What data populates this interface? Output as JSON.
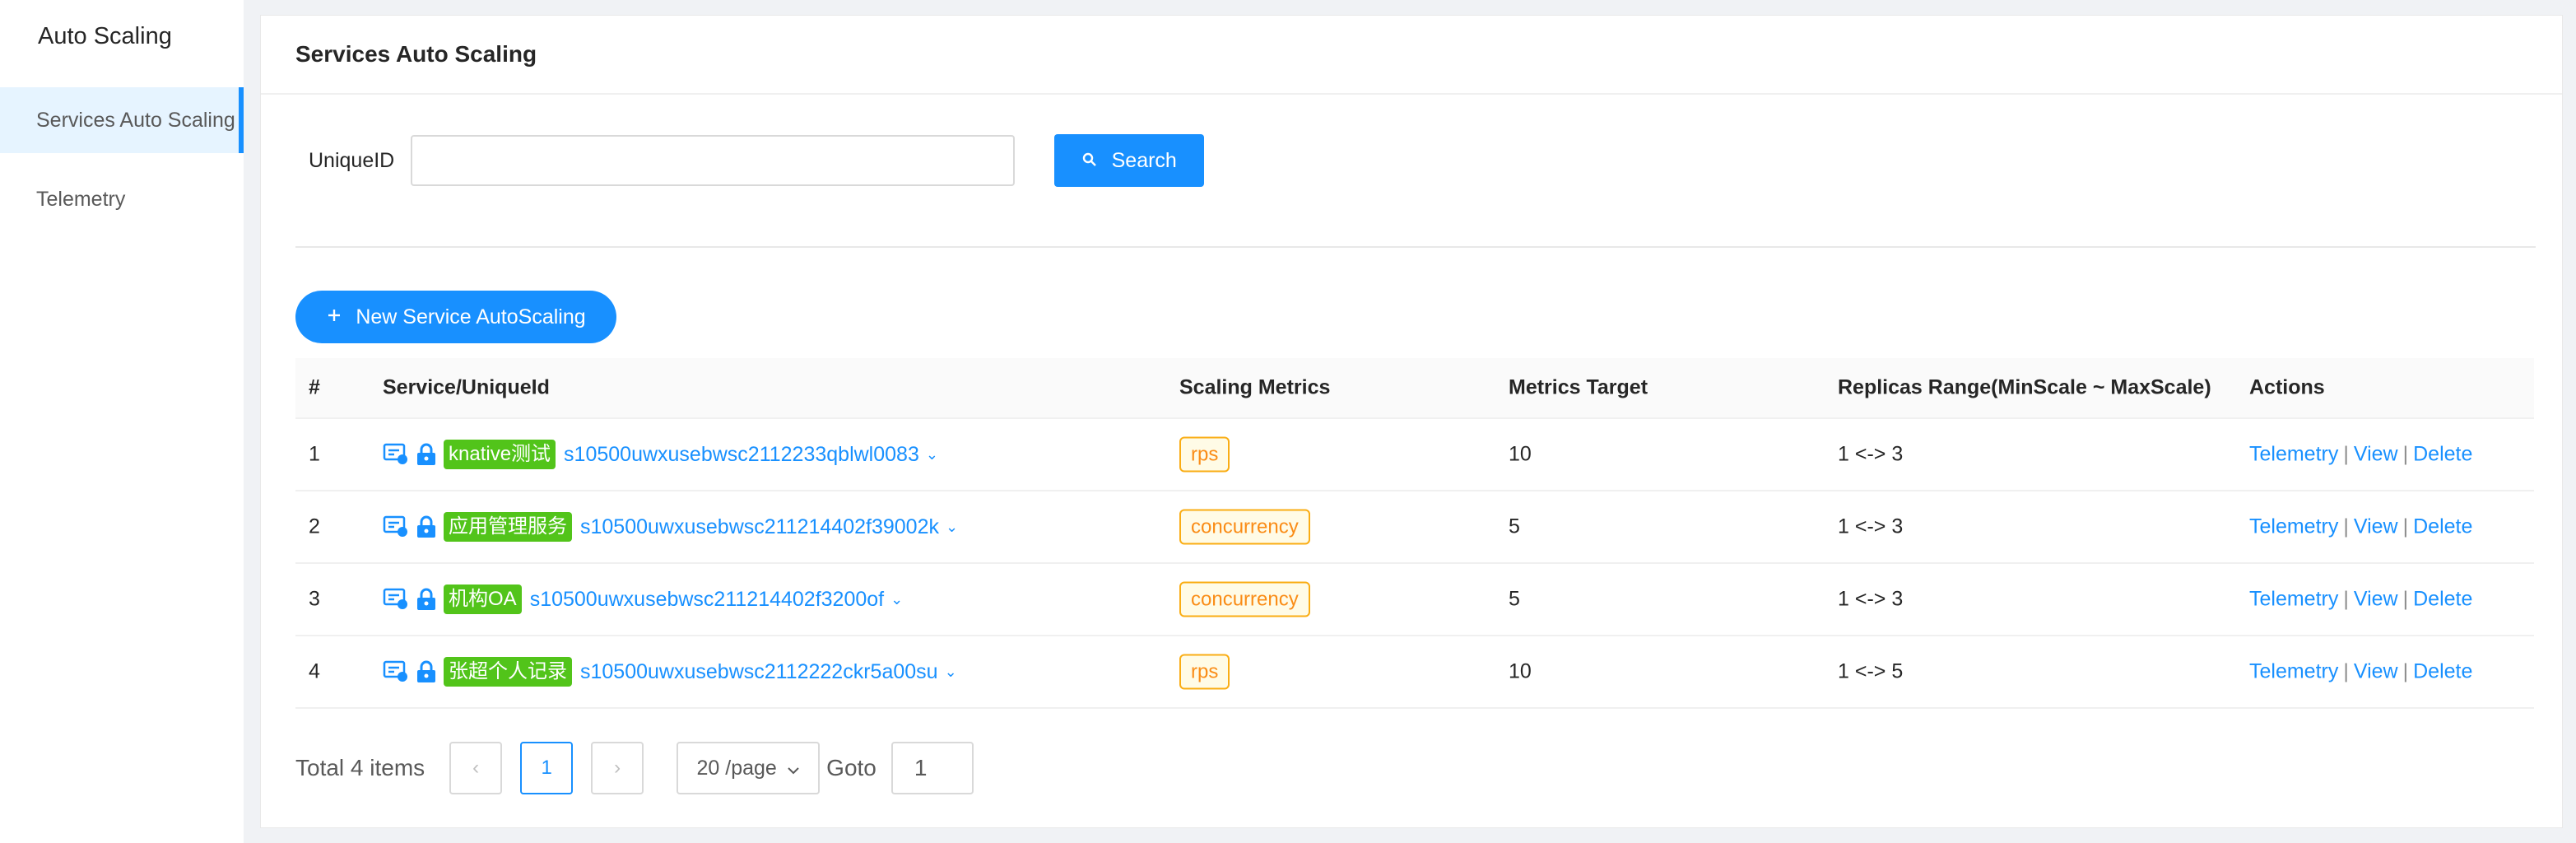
{
  "sidebar": {
    "title": "Auto Scaling",
    "items": [
      {
        "label": "Services Auto Scaling"
      },
      {
        "label": "Telemetry"
      }
    ]
  },
  "header": {
    "title": "Services Auto Scaling"
  },
  "search": {
    "label": "UniqueID",
    "value": "",
    "placeholder": "",
    "button_label": "Search"
  },
  "toolbar": {
    "new_label": "New Service AutoScaling"
  },
  "table": {
    "columns": [
      "#",
      "Service/UniqueId",
      "Scaling Metrics",
      "Metrics Target",
      "Replicas Range(MinScale ~ MaxScale)",
      "Actions"
    ],
    "rows": [
      {
        "index": "1",
        "name": "knative测试",
        "uid": "s10500uwxusebwsc2112233qblwl0083",
        "metric": "rps",
        "target": "10",
        "range": "1 <-> 3"
      },
      {
        "index": "2",
        "name": "应用管理服务",
        "uid": "s10500uwxusebwsc211214402f39002k",
        "metric": "concurrency",
        "target": "5",
        "range": "1 <-> 3"
      },
      {
        "index": "3",
        "name": "机构OA",
        "uid": "s10500uwxusebwsc211214402f3200of",
        "metric": "concurrency",
        "target": "5",
        "range": "1 <-> 3"
      },
      {
        "index": "4",
        "name": "张超个人记录",
        "uid": "s10500uwxusebwsc2112222ckr5a00su",
        "metric": "rps",
        "target": "10",
        "range": "1 <-> 5"
      }
    ],
    "actions": {
      "telemetry": "Telemetry",
      "view": "View",
      "delete": "Delete",
      "separator": "|"
    }
  },
  "pagination": {
    "total_label": "Total 4 items",
    "current_page": "1",
    "page_size_label": "20 /page",
    "goto_label": "Goto",
    "goto_value": "1"
  },
  "colors": {
    "primary": "#1890ff",
    "name_tag": "#52c41a",
    "metric_tag": "#fa8c16"
  },
  "icons": [
    "search-icon",
    "plus-icon",
    "service-card-icon",
    "lock-icon",
    "chevron-down-icon",
    "chevron-left-icon",
    "chevron-right-icon"
  ]
}
